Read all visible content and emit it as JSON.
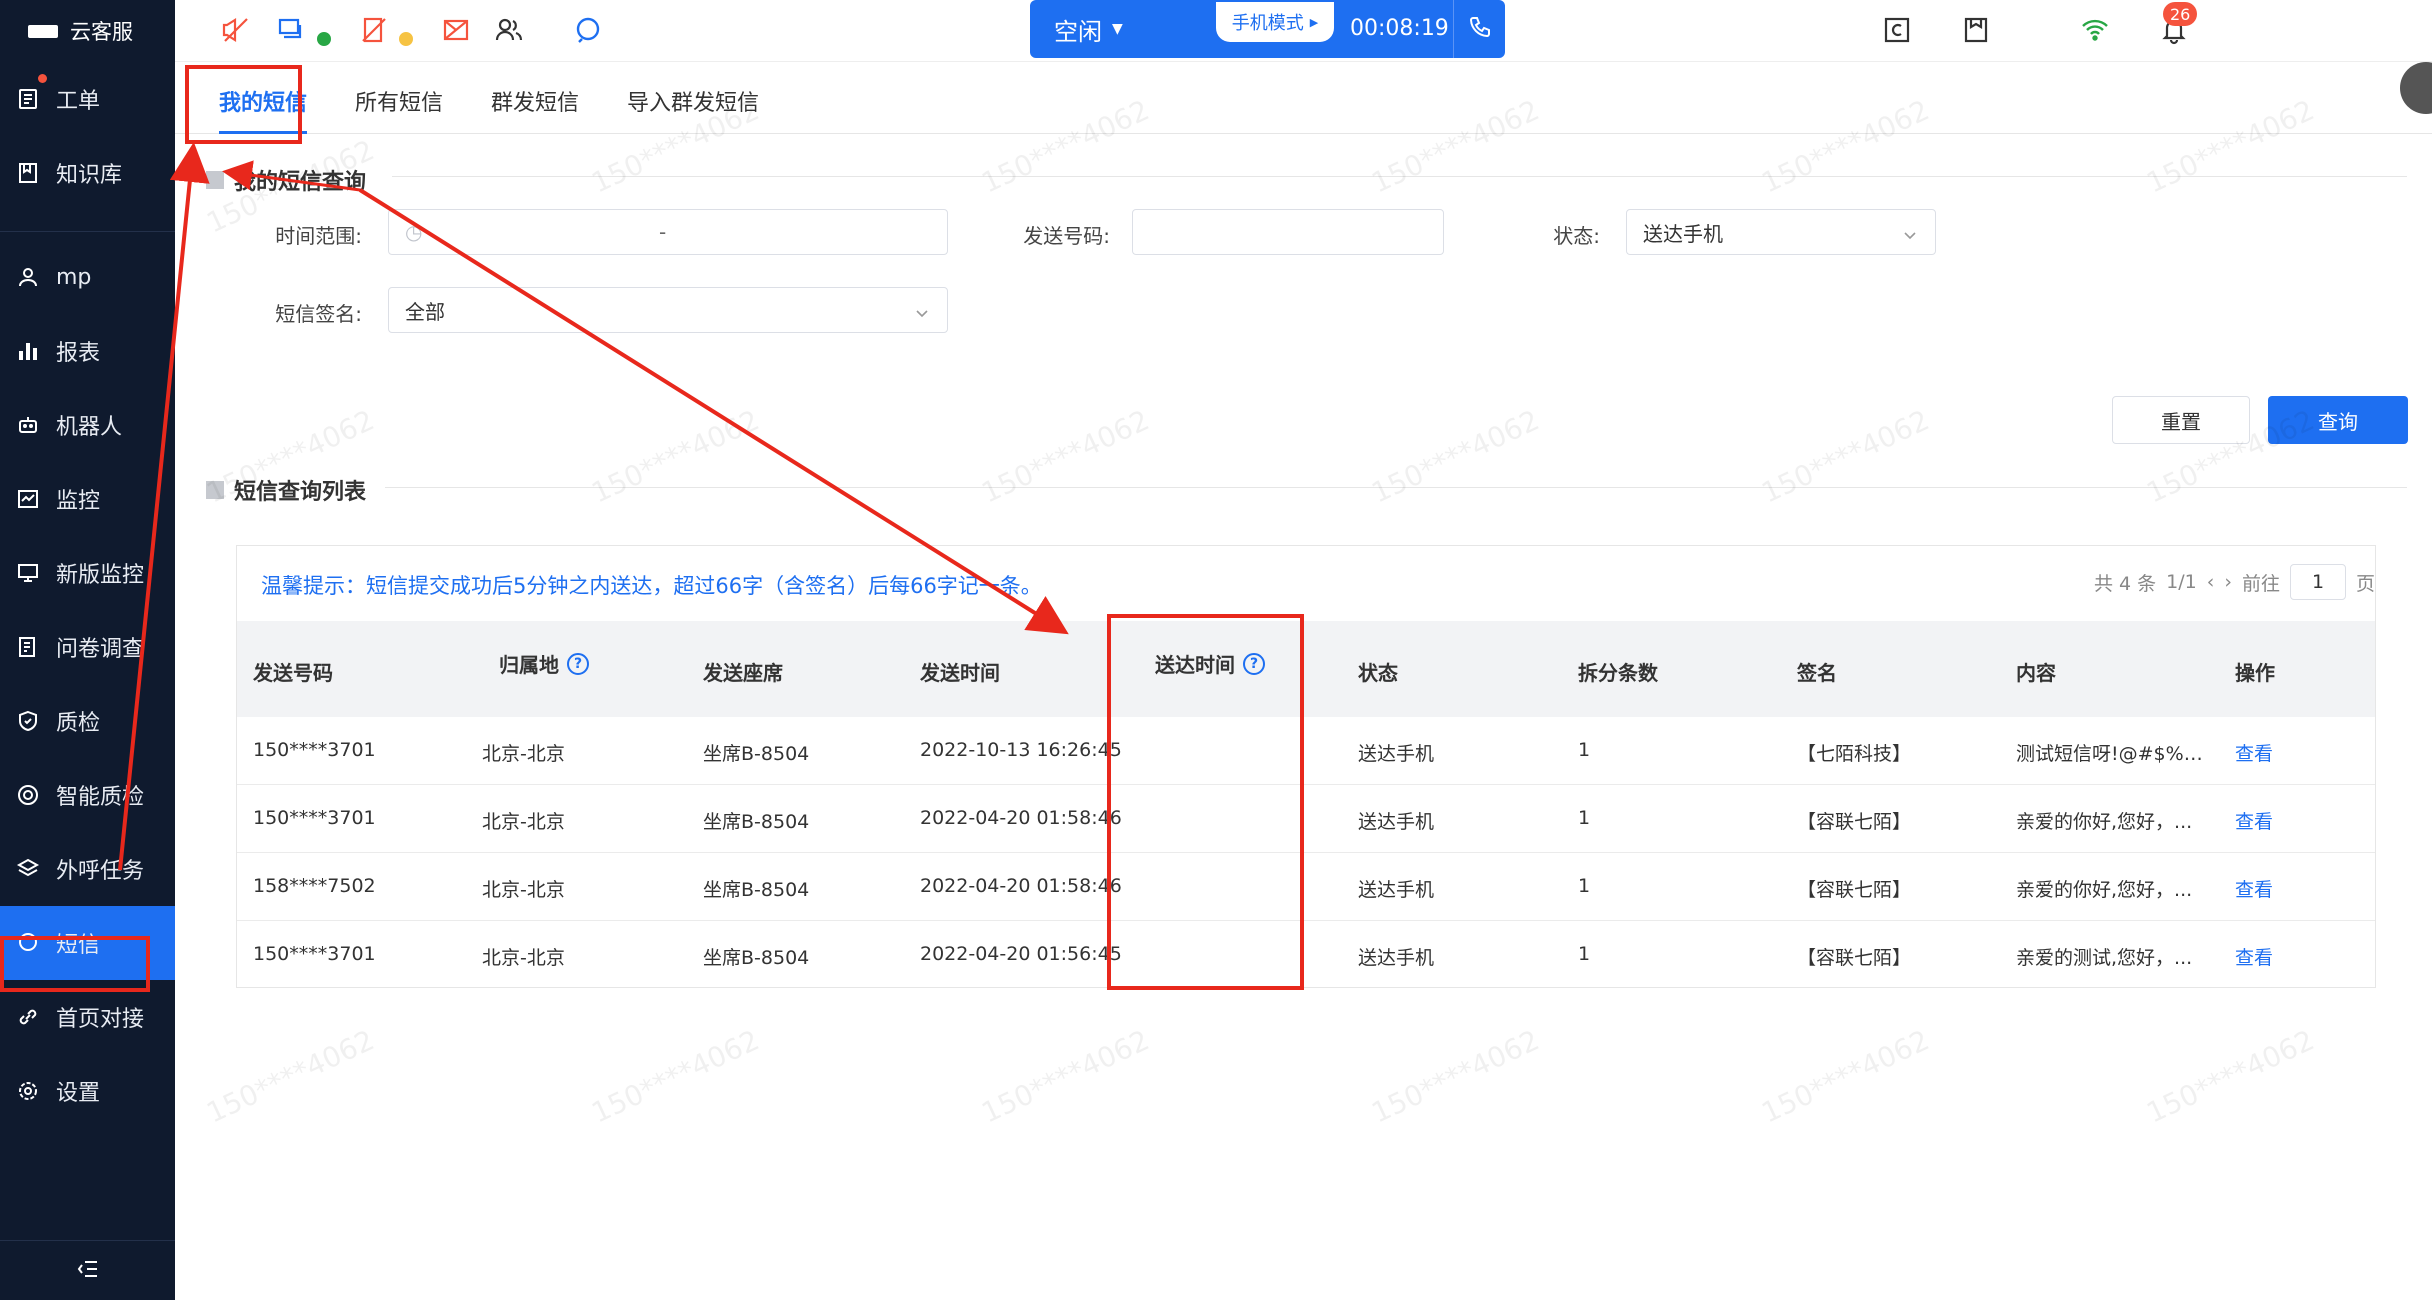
{
  "app": {
    "brand": "云客服"
  },
  "sidebar": {
    "items": [
      {
        "label": "工单",
        "icon": "ticket-icon"
      },
      {
        "label": "知识库",
        "icon": "book-icon"
      },
      {
        "label": "mp",
        "icon": "user-icon"
      },
      {
        "label": "报表",
        "icon": "bar-chart-icon"
      },
      {
        "label": "机器人",
        "icon": "robot-icon"
      },
      {
        "label": "监控",
        "icon": "monitor-icon"
      },
      {
        "label": "新版监控",
        "icon": "screen-icon"
      },
      {
        "label": "问卷调查",
        "icon": "survey-icon"
      },
      {
        "label": "质检",
        "icon": "shield-icon"
      },
      {
        "label": "智能质检",
        "icon": "target-icon"
      },
      {
        "label": "外呼任务",
        "icon": "layers-icon"
      },
      {
        "label": "短信",
        "icon": "message-icon"
      },
      {
        "label": "首页对接",
        "icon": "link-icon"
      },
      {
        "label": "设置",
        "icon": "gear-icon"
      }
    ],
    "active": "短信"
  },
  "topbar": {
    "status": "空闲",
    "mode": "手机模式",
    "timer": "00:08:19",
    "notification_count": "26"
  },
  "tabs": [
    "我的短信",
    "所有短信",
    "群发短信",
    "导入群发短信"
  ],
  "query": {
    "title": "我的短信查询",
    "time_range_label": "时间范围:",
    "time_range_sep": "-",
    "send_number_label": "发送号码:",
    "status_label": "状态:",
    "status_value": "送达手机",
    "signature_label": "短信签名:",
    "signature_value": "全部",
    "reset_label": "重置",
    "query_label": "查询"
  },
  "list": {
    "title": "短信查询列表",
    "tip": "温馨提示：短信提交成功后5分钟之内送达，超过66字（含签名）后每66字记一条。",
    "pager": {
      "total": "共 4 条",
      "pages": "1/1",
      "goto": "前往",
      "page": "1",
      "unit": "页"
    },
    "columns": [
      "发送号码",
      "归属地",
      "发送座席",
      "发送时间",
      "送达时间",
      "状态",
      "拆分条数",
      "签名",
      "内容",
      "操作"
    ],
    "rows": [
      {
        "number": "150****3701",
        "region": "北京-北京",
        "agent": "坐席B-8504",
        "send_time": "2022-10-13 16:26:45",
        "deliver_time": "",
        "status": "送达手机",
        "parts": "1",
        "sign": "【七陌科技】",
        "content": "测试短信呀!@#$%^...",
        "action": "查看"
      },
      {
        "number": "150****3701",
        "region": "北京-北京",
        "agent": "坐席B-8504",
        "send_time": "2022-04-20 01:58:46",
        "deliver_time": "",
        "status": "送达手机",
        "parts": "1",
        "sign": "【容联七陌】",
        "content": "亲爱的你好,您好，...",
        "action": "查看"
      },
      {
        "number": "158****7502",
        "region": "北京-北京",
        "agent": "坐席B-8504",
        "send_time": "2022-04-20 01:58:46",
        "deliver_time": "",
        "status": "送达手机",
        "parts": "1",
        "sign": "【容联七陌】",
        "content": "亲爱的你好,您好，...",
        "action": "查看"
      },
      {
        "number": "150****3701",
        "region": "北京-北京",
        "agent": "坐席B-8504",
        "send_time": "2022-04-20 01:56:45",
        "deliver_time": "",
        "status": "送达手机",
        "parts": "1",
        "sign": "【容联七陌】",
        "content": "亲爱的测试,您好，...",
        "action": "查看"
      }
    ]
  },
  "watermark": "150****4062",
  "colors": {
    "accent": "#1e6ff1",
    "sidebar_bg": "#0f1a2e",
    "annotation": "#e8281c",
    "orange_icon": "#f5533d"
  }
}
